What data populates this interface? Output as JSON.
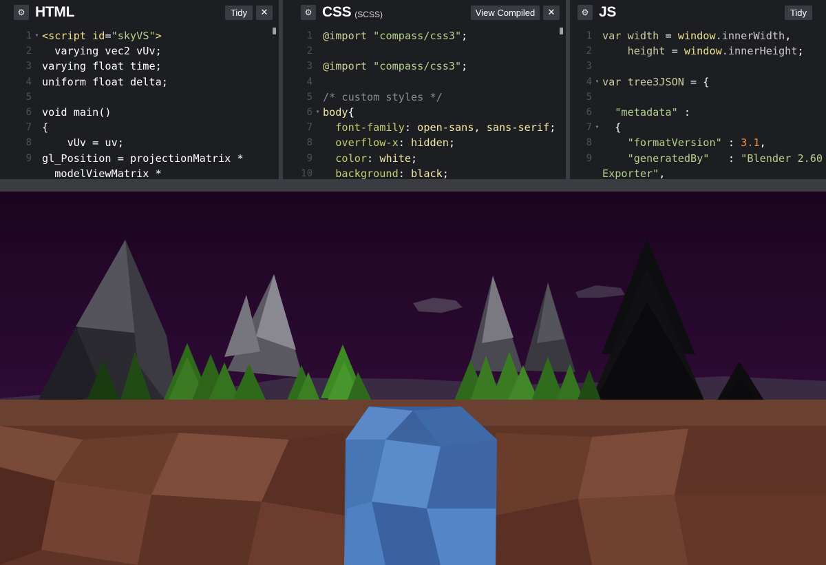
{
  "editors": {
    "html": {
      "title": "HTML",
      "tidy_label": "Tidy",
      "lines": [
        {
          "n": "1",
          "fold": "▾",
          "parts": [
            {
              "t": "<script ",
              "c": "t-tag"
            },
            {
              "t": "id",
              "c": "t-tag"
            },
            {
              "t": "=",
              "c": "txt"
            },
            {
              "t": "\"skyVS\"",
              "c": "t-str"
            },
            {
              "t": ">",
              "c": "t-tag"
            }
          ]
        },
        {
          "n": "2",
          "fold": "",
          "parts": [
            {
              "t": "  varying vec2 vUv;",
              "c": "txt"
            }
          ]
        },
        {
          "n": "3",
          "fold": "",
          "parts": [
            {
              "t": "varying float time;",
              "c": "txt"
            }
          ]
        },
        {
          "n": "4",
          "fold": "",
          "parts": [
            {
              "t": "uniform float delta;",
              "c": "txt"
            }
          ]
        },
        {
          "n": "5",
          "fold": "",
          "parts": [
            {
              "t": "",
              "c": "txt"
            }
          ]
        },
        {
          "n": "6",
          "fold": "",
          "parts": [
            {
              "t": "void main()",
              "c": "txt"
            }
          ]
        },
        {
          "n": "7",
          "fold": "",
          "parts": [
            {
              "t": "{",
              "c": "txt"
            }
          ]
        },
        {
          "n": "8",
          "fold": "",
          "parts": [
            {
              "t": "    vUv = uv;",
              "c": "txt"
            }
          ]
        },
        {
          "n": "9",
          "fold": "",
          "parts": [
            {
              "t": "gl_Position = projectionMatrix *",
              "c": "txt"
            }
          ]
        },
        {
          "n": "",
          "fold": "",
          "parts": [
            {
              "t": "  modelViewMatrix *",
              "c": "txt"
            }
          ]
        }
      ]
    },
    "css": {
      "title": "CSS",
      "subtitle": "(SCSS)",
      "view_compiled_label": "View Compiled",
      "lines": [
        {
          "n": "1",
          "fold": "",
          "parts": [
            {
              "t": "@import ",
              "c": "t-kw"
            },
            {
              "t": "\"compass/css3\"",
              "c": "t-str"
            },
            {
              "t": ";",
              "c": "txt"
            }
          ]
        },
        {
          "n": "2",
          "fold": "",
          "parts": [
            {
              "t": "",
              "c": "txt"
            }
          ]
        },
        {
          "n": "3",
          "fold": "",
          "parts": [
            {
              "t": "@import ",
              "c": "t-kw"
            },
            {
              "t": "\"compass/css3\"",
              "c": "t-str"
            },
            {
              "t": ";",
              "c": "txt"
            }
          ]
        },
        {
          "n": "4",
          "fold": "",
          "parts": [
            {
              "t": "",
              "c": "txt"
            }
          ]
        },
        {
          "n": "5",
          "fold": "",
          "parts": [
            {
              "t": "/* custom styles */",
              "c": "t-com"
            }
          ]
        },
        {
          "n": "6",
          "fold": "▾",
          "parts": [
            {
              "t": "body",
              "c": "t-sel"
            },
            {
              "t": "{",
              "c": "txt"
            }
          ]
        },
        {
          "n": "7",
          "fold": "",
          "parts": [
            {
              "t": "  font-family",
              "c": "t-prop"
            },
            {
              "t": ": ",
              "c": "txt"
            },
            {
              "t": "open-sans, sans-serif",
              "c": "t-sel"
            },
            {
              "t": ";",
              "c": "txt"
            }
          ]
        },
        {
          "n": "8",
          "fold": "",
          "parts": [
            {
              "t": "  overflow-x",
              "c": "t-prop"
            },
            {
              "t": ": ",
              "c": "txt"
            },
            {
              "t": "hidden",
              "c": "t-sel"
            },
            {
              "t": ";",
              "c": "txt"
            }
          ]
        },
        {
          "n": "9",
          "fold": "",
          "parts": [
            {
              "t": "  color",
              "c": "t-prop"
            },
            {
              "t": ": ",
              "c": "txt"
            },
            {
              "t": "white",
              "c": "t-sel"
            },
            {
              "t": ";",
              "c": "txt"
            }
          ]
        },
        {
          "n": "10",
          "fold": "",
          "parts": [
            {
              "t": "  background",
              "c": "t-prop"
            },
            {
              "t": ": ",
              "c": "txt"
            },
            {
              "t": "black",
              "c": "t-sel"
            },
            {
              "t": ";",
              "c": "txt"
            }
          ]
        }
      ]
    },
    "js": {
      "title": "JS",
      "tidy_label": "Tidy",
      "lines": [
        {
          "n": "1",
          "fold": "",
          "parts": [
            {
              "t": "var ",
              "c": "t-var"
            },
            {
              "t": "width",
              "c": "t-var"
            },
            {
              "t": " = ",
              "c": "txt"
            },
            {
              "t": "window",
              "c": "t-win"
            },
            {
              "t": ".innerWidth",
              "c": "t-prp"
            },
            {
              "t": ",",
              "c": "txt"
            }
          ]
        },
        {
          "n": "2",
          "fold": "",
          "parts": [
            {
              "t": "    height",
              "c": "t-var"
            },
            {
              "t": " = ",
              "c": "txt"
            },
            {
              "t": "window",
              "c": "t-win"
            },
            {
              "t": ".innerHeight",
              "c": "t-prp"
            },
            {
              "t": ";",
              "c": "txt"
            }
          ]
        },
        {
          "n": "3",
          "fold": "",
          "parts": [
            {
              "t": "",
              "c": "txt"
            }
          ]
        },
        {
          "n": "4",
          "fold": "▾",
          "parts": [
            {
              "t": "var ",
              "c": "t-var"
            },
            {
              "t": "tree3JSON",
              "c": "t-var"
            },
            {
              "t": " = {",
              "c": "txt"
            }
          ]
        },
        {
          "n": "5",
          "fold": "",
          "parts": [
            {
              "t": "",
              "c": "txt"
            }
          ]
        },
        {
          "n": "6",
          "fold": "",
          "parts": [
            {
              "t": "  \"metadata\"",
              "c": "t-str"
            },
            {
              "t": " :",
              "c": "txt"
            }
          ]
        },
        {
          "n": "7",
          "fold": "▾",
          "parts": [
            {
              "t": "  {",
              "c": "txt"
            }
          ]
        },
        {
          "n": "8",
          "fold": "",
          "parts": [
            {
              "t": "    \"formatVersion\"",
              "c": "t-str"
            },
            {
              "t": " : ",
              "c": "txt"
            },
            {
              "t": "3.1",
              "c": "t-num"
            },
            {
              "t": ",",
              "c": "txt"
            }
          ]
        },
        {
          "n": "9",
          "fold": "",
          "parts": [
            {
              "t": "    \"generatedBy\"",
              "c": "t-str"
            },
            {
              "t": "   : ",
              "c": "txt"
            },
            {
              "t": "\"Blender 2.60",
              "c": "t-str"
            }
          ]
        },
        {
          "n": "",
          "fold": "",
          "parts": [
            {
              "t": "Exporter\"",
              "c": "t-str"
            },
            {
              "t": ",",
              "c": "txt"
            }
          ]
        }
      ]
    }
  },
  "icons": {
    "settings": "gear-icon",
    "close": "close-icon"
  },
  "colors": {
    "editor_bg": "#1d1e22",
    "divider": "#3a3c42",
    "sky": "#2a0a2f",
    "ground": "#6e3e30",
    "water": "#4a78b8",
    "trees": "#3f8a25"
  }
}
